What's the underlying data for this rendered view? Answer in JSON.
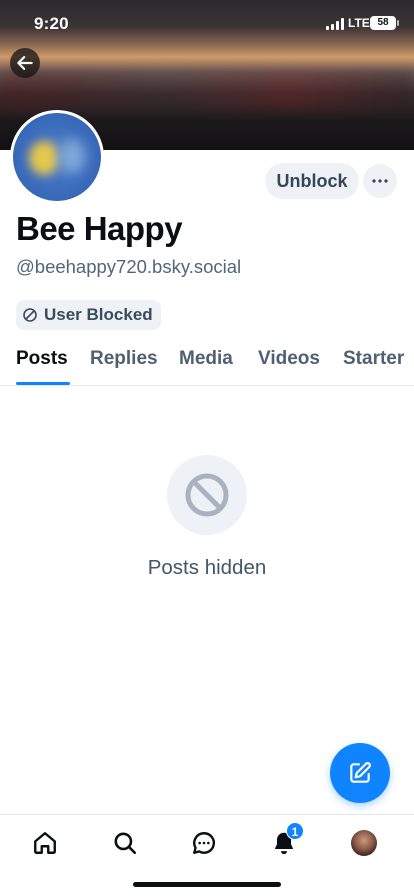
{
  "status_bar": {
    "time": "9:20",
    "network": "LTE",
    "battery": "58"
  },
  "profile": {
    "display_name": "Bee Happy",
    "handle": "@beehappy720.bsky.social",
    "unblock_label": "Unblock",
    "more_label": "···",
    "blocked_badge": "User Blocked"
  },
  "tabs": [
    {
      "label": "Posts",
      "active": true
    },
    {
      "label": "Replies",
      "active": false
    },
    {
      "label": "Media",
      "active": false
    },
    {
      "label": "Videos",
      "active": false
    },
    {
      "label": "Starter",
      "active": false
    }
  ],
  "content": {
    "empty_message": "Posts hidden"
  },
  "bottom_nav": {
    "items": [
      "home-icon",
      "search-icon",
      "chat-icon",
      "bell-icon",
      "profile-avatar"
    ],
    "notification_count": "1"
  },
  "colors": {
    "accent": "#1083fe",
    "muted_text": "#52657a",
    "chip_background": "#eef1f5"
  }
}
